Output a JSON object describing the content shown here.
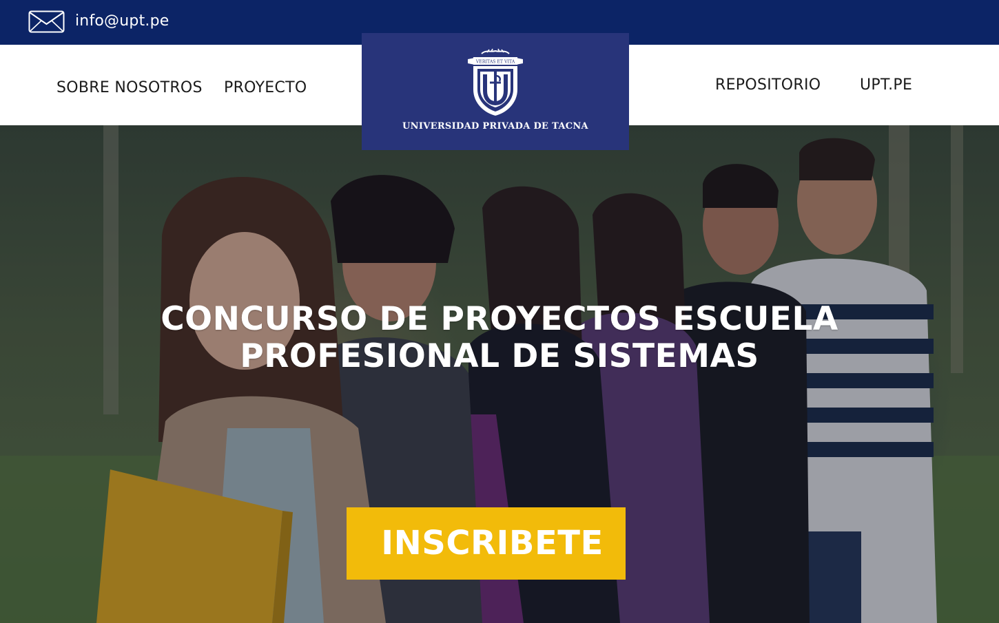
{
  "topbar": {
    "email": "info@upt.pe",
    "email_icon": "mail-icon",
    "background_color": "#0c2466"
  },
  "nav": {
    "left_items": [
      {
        "label": "SOBRE NOSOTROS"
      },
      {
        "label": "PROYECTO"
      }
    ],
    "right_items": [
      {
        "label": "REPOSITORIO"
      },
      {
        "label": "UPT.PE"
      }
    ]
  },
  "logo": {
    "name": "UNIVERSIDAD PRIVADA DE TACNA",
    "motto": "VERITAS ET VITA",
    "background_color": "#28347a"
  },
  "hero": {
    "title_line1": "CONCURSO DE PROYECTOS ESCUELA",
    "title_line2": "PROFESIONAL DE SISTEMAS",
    "cta_label": "INSCRIBETE",
    "cta_color": "#f2bb0a"
  }
}
